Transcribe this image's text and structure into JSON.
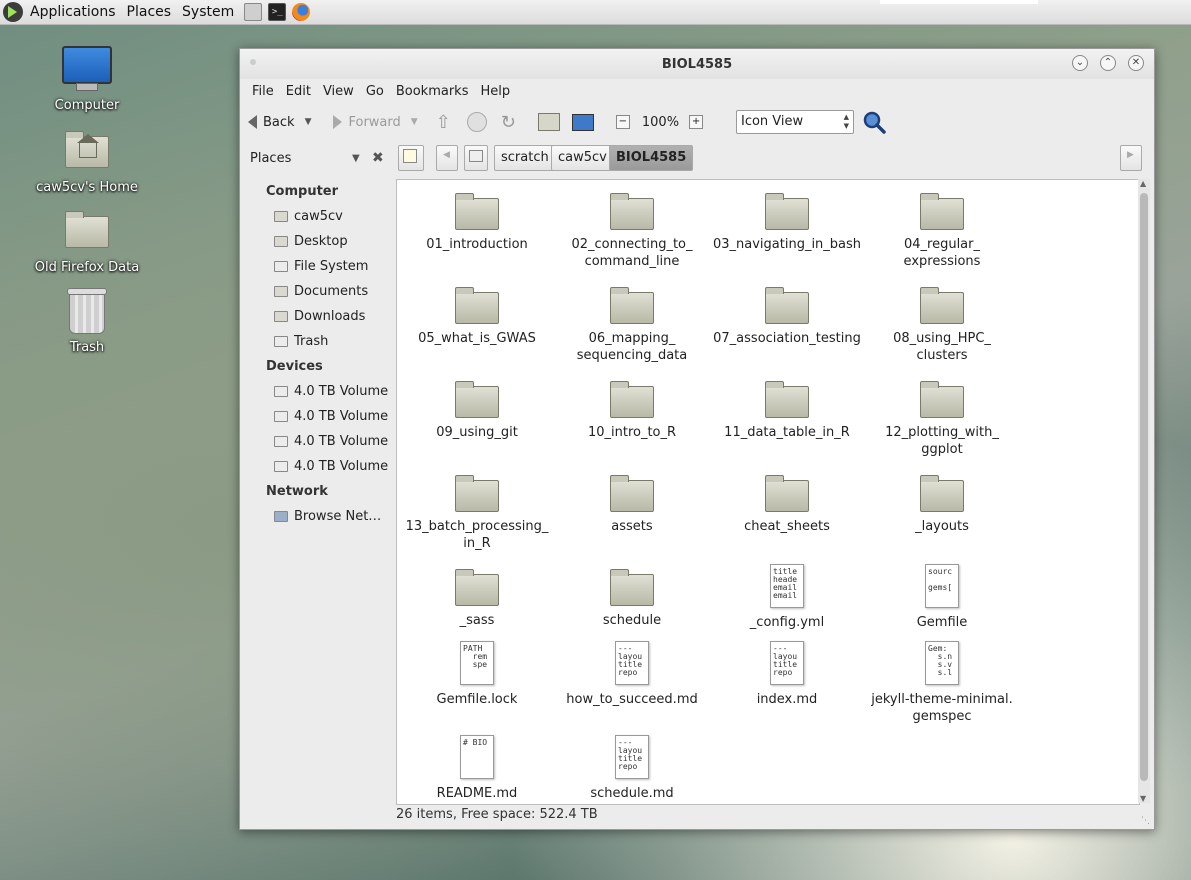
{
  "panel": {
    "menus": [
      "Applications",
      "Places",
      "System"
    ]
  },
  "desktop": {
    "icons": [
      {
        "label": "Computer"
      },
      {
        "label": "caw5cv's Home"
      },
      {
        "label": "Old Firefox Data"
      },
      {
        "label": "Trash"
      }
    ]
  },
  "window": {
    "title": "BIOL4585",
    "menubar": [
      "File",
      "Edit",
      "View",
      "Go",
      "Bookmarks",
      "Help"
    ],
    "toolbar": {
      "back": "Back",
      "forward": "Forward",
      "zoom": "100%",
      "view_mode": "Icon View"
    },
    "sidebar": {
      "title": "Places",
      "sections": [
        {
          "name": "Computer",
          "items": [
            "caw5cv",
            "Desktop",
            "File System",
            "Documents",
            "Downloads",
            "Trash"
          ]
        },
        {
          "name": "Devices",
          "items": [
            "4.0 TB Volume",
            "4.0 TB Volume",
            "4.0 TB Volume",
            "4.0 TB Volume"
          ]
        },
        {
          "name": "Network",
          "items": [
            "Browse Net…"
          ]
        }
      ]
    },
    "path": [
      "scratch",
      "caw5cv",
      "BIOL4585"
    ],
    "items": [
      {
        "name": "01_introduction",
        "type": "folder"
      },
      {
        "name": "02_connecting_to_\ncommand_line",
        "type": "folder"
      },
      {
        "name": "03_navigating_in_bash",
        "type": "folder"
      },
      {
        "name": "04_regular_\nexpressions",
        "type": "folder"
      },
      {
        "name": "05_what_is_GWAS",
        "type": "folder"
      },
      {
        "name": "06_mapping_\nsequencing_data",
        "type": "folder"
      },
      {
        "name": "07_association_testing",
        "type": "folder"
      },
      {
        "name": "08_using_HPC_\nclusters",
        "type": "folder"
      },
      {
        "name": "09_using_git",
        "type": "folder"
      },
      {
        "name": "10_intro_to_R",
        "type": "folder"
      },
      {
        "name": "11_data_table_in_R",
        "type": "folder"
      },
      {
        "name": "12_plotting_with_\nggplot",
        "type": "folder"
      },
      {
        "name": "13_batch_processing_\nin_R",
        "type": "folder"
      },
      {
        "name": "assets",
        "type": "folder"
      },
      {
        "name": "cheat_sheets",
        "type": "folder"
      },
      {
        "name": "_layouts",
        "type": "folder"
      },
      {
        "name": "_sass",
        "type": "folder"
      },
      {
        "name": "schedule",
        "type": "folder"
      },
      {
        "name": "_config.yml",
        "type": "file",
        "preview": "title\nheade\nemail\nemail"
      },
      {
        "name": "Gemfile",
        "type": "file",
        "preview": "sourc\n\ngems["
      },
      {
        "name": "Gemfile.lock",
        "type": "file",
        "preview": "PATH\n  rem\n  spe"
      },
      {
        "name": "how_to_succeed.md",
        "type": "file",
        "preview": "---\nlayou\ntitle\nrepo"
      },
      {
        "name": "index.md",
        "type": "file",
        "preview": "---\nlayou\ntitle\nrepo"
      },
      {
        "name": "jekyll-theme-minimal.\ngemspec",
        "type": "file",
        "preview": "Gem:\n  s.n\n  s.v\n  s.l"
      },
      {
        "name": "README.md",
        "type": "file",
        "preview": "# BIO"
      },
      {
        "name": "schedule.md",
        "type": "file",
        "preview": "---\nlayou\ntitle\nrepo"
      }
    ],
    "status": "26 items, Free space: 522.4 TB"
  }
}
